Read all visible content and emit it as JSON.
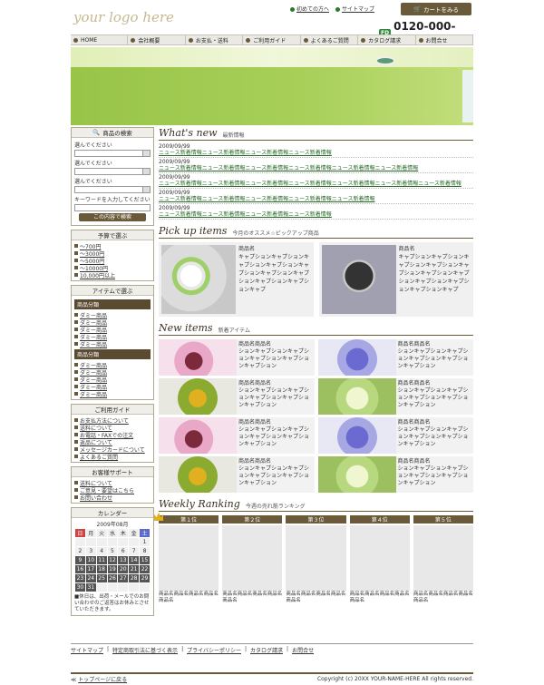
{
  "header": {
    "logo": "your logo here",
    "first_time": "初めての方へ",
    "sitemap": "サイトマップ",
    "cart": "カートをみる",
    "phone": "0120-000-000",
    "free_dial": "FD"
  },
  "nav": [
    "HOME",
    "会社概要",
    "お支払・送料",
    "ご利用ガイド",
    "よくあるご質問",
    "カタログ請求",
    "お問合せ"
  ],
  "side": {
    "search": {
      "title": "商品の検索",
      "choose1": "選んでください",
      "choose2": "選んでください",
      "choose3": "選んでください",
      "keyword": "キーワードを入力してください",
      "button": "この内容で検索"
    },
    "budget": {
      "title": "予算で選ぶ",
      "items": [
        "～700円",
        "～3000円",
        "～5000円",
        "～10000円",
        "10,000円以上"
      ]
    },
    "item": {
      "title": "アイテムで選ぶ",
      "cat1": "商品分類",
      "list1": [
        "ダミー商品",
        "ダミー商品",
        "ダミー商品",
        "ダミー商品",
        "ダミー商品"
      ],
      "cat2": "商品分類",
      "list2": [
        "ダミー商品",
        "ダミー商品",
        "ダミー商品",
        "ダミー商品",
        "ダミー商品"
      ]
    },
    "guide": {
      "title": "ご利用ガイド",
      "items": [
        "お支払方法について",
        "送料について",
        "お電話・FAXでの注文",
        "返品について",
        "メッセージカードについて",
        "よくあるご質問"
      ]
    },
    "support": {
      "title": "お客様サポート",
      "items": [
        "送料について",
        "ご意見・要望はこちら",
        "お問い合わせ"
      ]
    },
    "calendar": {
      "title": "カレンダー",
      "month": "2009年08月",
      "week": [
        "日",
        "月",
        "火",
        "水",
        "木",
        "金",
        "土"
      ],
      "rows": [
        [
          "",
          "",
          "",
          "",
          "",
          "",
          "1"
        ],
        [
          "2",
          "3",
          "4",
          "5",
          "6",
          "7",
          "8"
        ],
        [
          "9",
          "10",
          "11",
          "12",
          "13",
          "14",
          "15"
        ],
        [
          "16",
          "17",
          "18",
          "19",
          "20",
          "21",
          "22"
        ],
        [
          "23",
          "24",
          "25",
          "26",
          "27",
          "28",
          "29"
        ],
        [
          "30",
          "31",
          "",
          "",
          "",
          "",
          "",
          ""
        ]
      ],
      "note": "■休日は、出荷・メールでのお問い合わせのご返答はお休みとさせていただきます。"
    }
  },
  "whatsnew": {
    "title": "What's new",
    "sub": "最新情報",
    "items": [
      {
        "date": "2009/09/99",
        "text": "ニュース新着情報ニュース新着情報ニュース新着情報ニュース新着情報"
      },
      {
        "date": "2009/09/99",
        "text": "ニュース新着情報ニュース新着情報ニュース新着情報ニュース新着情報ニュース新着情報ニュース新着情報"
      },
      {
        "date": "2009/09/99",
        "text": "ニュース新着情報ニュース新着情報ニュース新着情報ニュース新着情報ニュース新着情報ニュース新着情報ニュース新着情報"
      },
      {
        "date": "2009/09/99",
        "text": "ニュース新着情報ニュース新着情報ニュース新着情報ニュース新着情報ニュース新着情報"
      },
      {
        "date": "2009/09/99",
        "text": "ニュース新着情報ニュース新着情報ニュース新着情報ニュース新着情報"
      }
    ]
  },
  "pickup": {
    "title": "Pick up items",
    "sub": "今月のオススメ☆ピックアップ商品",
    "items": [
      {
        "name": "商品名",
        "desc": "キャプションキャプションキャプションキャプションキャプションキャプションキャプションキャプションキャプションキャプ"
      },
      {
        "name": "商品名",
        "desc": "キャプションキャプションキャプションキャプションキャプションキャプションキャプションキャプションキャプションキャプションキャプ"
      }
    ]
  },
  "newitems": {
    "title": "New items",
    "sub": "新着アイテム",
    "items": [
      {
        "name": "商品名商品名",
        "desc": "ションキャプションキャプションキャプションキャプションキャプション"
      },
      {
        "name": "商品名商品名",
        "desc": "ションキャプションキャプションキャプションキャプションキャプション"
      },
      {
        "name": "商品名商品名",
        "desc": "ションキャプションキャプションキャプションキャプションキャプション"
      },
      {
        "name": "商品名商品名",
        "desc": "ションキャプションキャプションキャプションキャプションキャプション"
      },
      {
        "name": "商品名商品名",
        "desc": "ションキャプションキャプションキャプションキャプションキャプション"
      },
      {
        "name": "商品名商品名",
        "desc": "ションキャプションキャプションキャプションキャプションキャプション"
      },
      {
        "name": "商品名商品名",
        "desc": "ションキャプションキャプションキャプションキャプションキャプション"
      },
      {
        "name": "商品名商品名",
        "desc": "ションキャプションキャプションキャプションキャプションキャプション"
      }
    ]
  },
  "ranking": {
    "title": "Weekly Ranking",
    "sub": "今週の売れ筋ランキング",
    "items": [
      {
        "label": "第１位",
        "caption": "商品名商品名商品名商品名商品名"
      },
      {
        "label": "第２位",
        "caption": "商品名商品名商品名商品名商品名"
      },
      {
        "label": "第３位",
        "caption": "商品名商品名商品名商品名商品名"
      },
      {
        "label": "第４位",
        "caption": "商品名商品名商品名商品名商品名"
      },
      {
        "label": "第５位",
        "caption": "商品名商品名商品名商品名商品名"
      }
    ]
  },
  "footer": {
    "links": [
      "サイトマップ",
      "特定商取引法に基づく表示",
      "プライバシーポリシー",
      "カタログ請求",
      "お問合せ"
    ],
    "back": "トップページに戻る",
    "copy": "Copyright (c) 20XX YOUR-NAME-HERE All rights reserved."
  }
}
